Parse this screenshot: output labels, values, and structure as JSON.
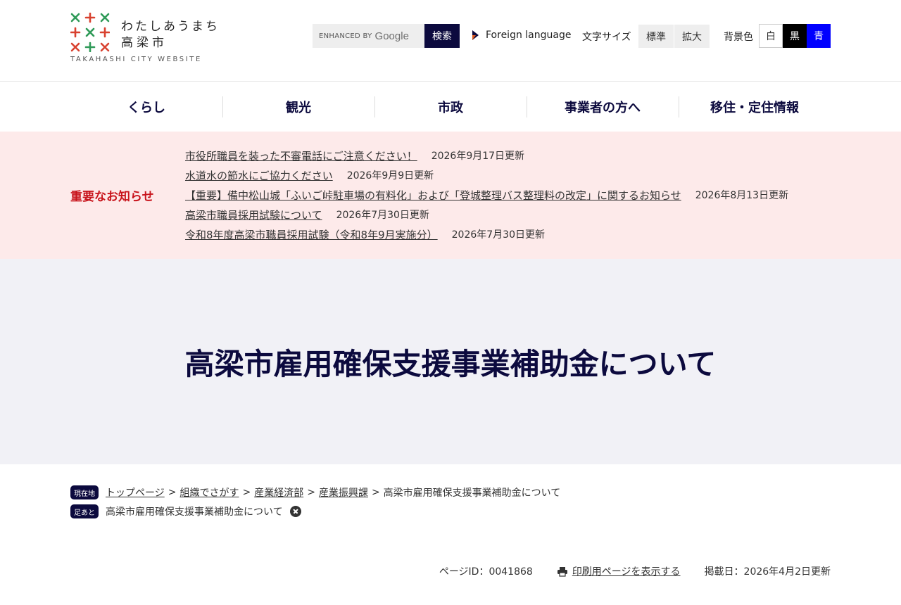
{
  "header": {
    "logo_line1": "わたしあうまち",
    "logo_line2": "高梁市",
    "logo_en": "TAKAHASHI CITY WEBSITE",
    "search": {
      "enhanced_by": "ENHANCED BY",
      "google": "Google",
      "button_label": "検索"
    },
    "foreign_language": "Foreign language",
    "font_size": {
      "label": "文字サイズ",
      "standard": "標準",
      "large": "拡大"
    },
    "bg_color": {
      "label": "背景色",
      "white": "白",
      "black": "黒",
      "blue": "青"
    }
  },
  "colors": {
    "navy": "#0c0a3e",
    "notice_bg": "#fdeaea",
    "notice_title": "#c8131b",
    "title_band_bg": "#f1f1f6",
    "blue_bg_button": "#0000ff",
    "logo_green": "#2f9a58",
    "logo_red": "#d8412f"
  },
  "nav": {
    "items": [
      "くらし",
      "観光",
      "市政",
      "事業者の方へ",
      "移住・定住情報"
    ]
  },
  "notices": {
    "title": "重要なお知らせ",
    "items": [
      {
        "text": "市役所職員を装った不審電話にご注意ください！",
        "date": "2026年9月17日更新"
      },
      {
        "text": "水道水の節水にご協力ください",
        "date": "2026年9月9日更新"
      },
      {
        "text": "【重要】備中松山城「ふいご峠駐車場の有料化」および「登城整理バス整理料の改定」に関するお知らせ",
        "date": "2026年8月13日更新"
      },
      {
        "text": "高梁市職員採用試験について",
        "date": "2026年7月30日更新"
      },
      {
        "text": "令和8年度高梁市職員採用試験（令和8年9月実施分）",
        "date": "2026年7月30日更新"
      }
    ]
  },
  "page": {
    "title": "高梁市雇用確保支援事業補助金について"
  },
  "breadcrumb": {
    "current_tag": "現在地",
    "items": [
      "トップページ",
      "組織でさがす",
      "産業経済部",
      "産業振興課"
    ],
    "separator": ">",
    "current": "高梁市雇用確保支援事業補助金について"
  },
  "footprint": {
    "tag": "足あと",
    "item": "高梁市雇用確保支援事業補助金について"
  },
  "meta": {
    "page_id": "ページID：0041868",
    "print_label": "印刷用ページを表示する",
    "published": "掲載日：2026年4月2日更新"
  }
}
